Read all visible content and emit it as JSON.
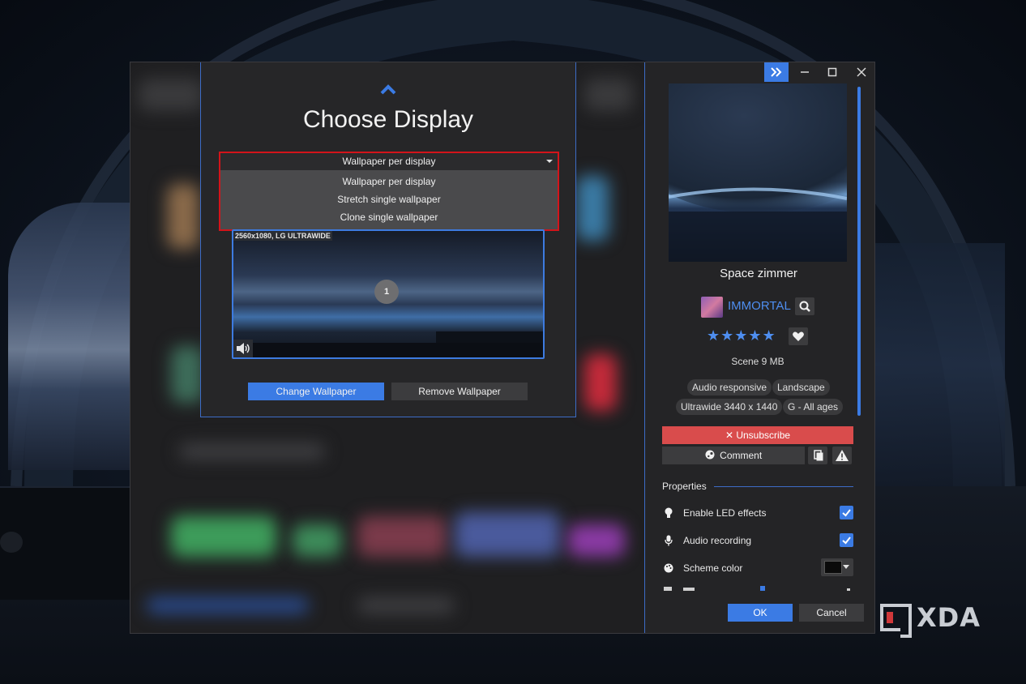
{
  "choose_display": {
    "title": "Choose Display",
    "select": {
      "selected": "Wallpaper per display",
      "options": [
        "Wallpaper per display",
        "Stretch single wallpaper",
        "Clone single wallpaper"
      ]
    },
    "display": {
      "label": "2560x1080, LG ULTRAWIDE",
      "number": "1"
    },
    "change_button": "Change Wallpaper",
    "remove_button": "Remove Wallpaper"
  },
  "panel": {
    "wallpaper_title": "Space zimmer",
    "author": "IMMORTAL",
    "rating_stars": "★★★★★",
    "rating_value": 5,
    "meta": "Scene  9 MB",
    "tags": [
      "Audio responsive",
      "Landscape",
      "Ultrawide 3440 x 1440",
      "G - All ages"
    ],
    "unsubscribe_label": "✕ Unsubscribe",
    "comment_label": "Comment",
    "properties_heading": "Properties",
    "properties": [
      {
        "label": "Enable LED effects",
        "checked": true
      },
      {
        "label": "Audio recording",
        "checked": true
      },
      {
        "label": "Scheme color",
        "value": "#0a0a0a"
      }
    ],
    "ok_label": "OK",
    "cancel_label": "Cancel"
  },
  "watermark": "XDA",
  "colors": {
    "accent": "#3b7be4",
    "unsubscribe": "#d94c4c",
    "highlight_border": "#d3141a"
  }
}
